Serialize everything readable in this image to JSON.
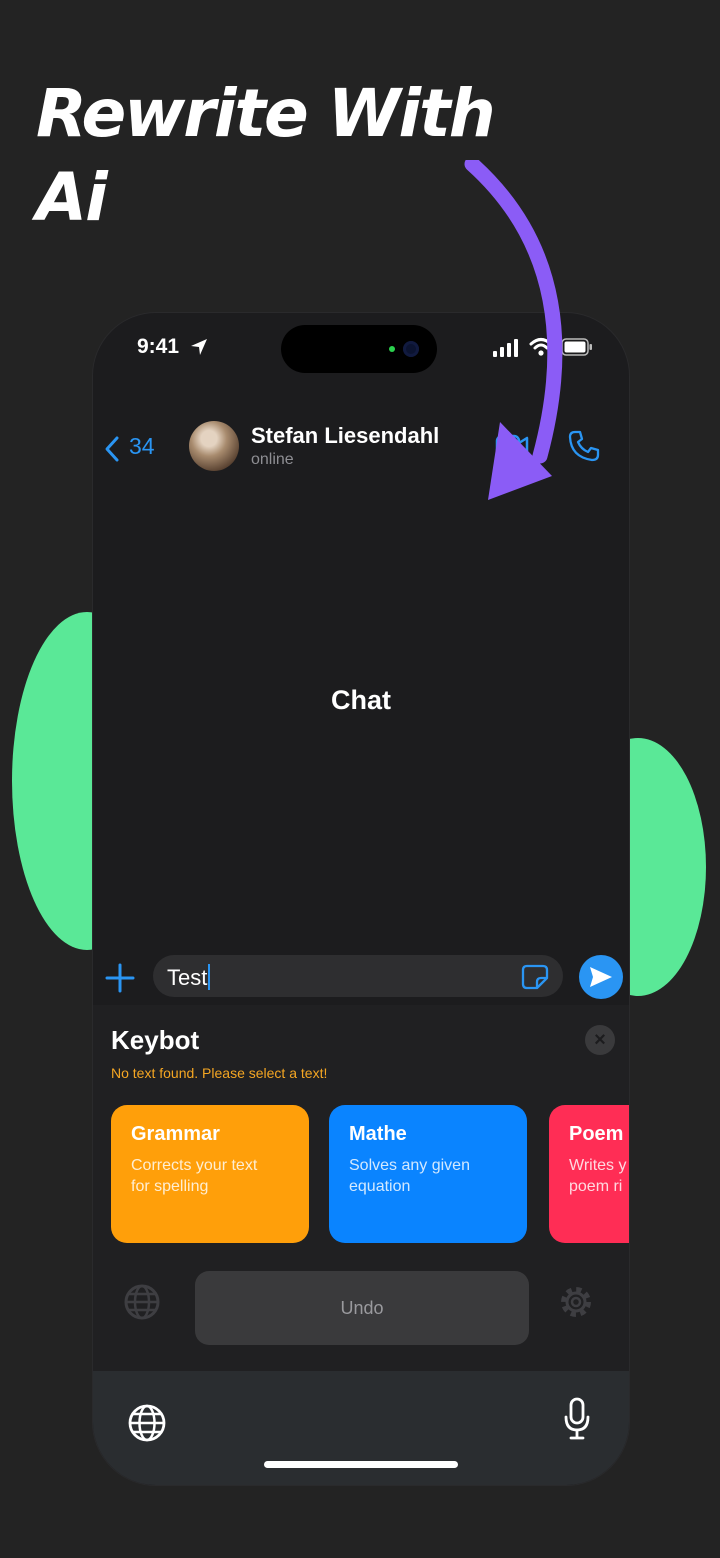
{
  "headline": {
    "line1": "Rewrite With",
    "line2": "Ai"
  },
  "status_bar": {
    "time": "9:41"
  },
  "chat_header": {
    "back_count": "34",
    "contact_name": "Stefan Liesendahl",
    "contact_status": "online"
  },
  "chat": {
    "placeholder_label": "Chat"
  },
  "composer": {
    "text": "Test"
  },
  "keybot": {
    "title": "Keybot",
    "hint": "No text found. Please select a text!",
    "close_glyph": "×",
    "cards": [
      {
        "title": "Grammar",
        "description_line1": "Corrects your text",
        "description_line2": "for spelling",
        "color": "#ff9f0a"
      },
      {
        "title": "Mathe",
        "description_line1": "Solves any given",
        "description_line2": "equation",
        "color": "#0a84ff"
      },
      {
        "title": "Poem",
        "description_line1": "Writes y",
        "description_line2": "poem ri",
        "color": "#ff2d55"
      }
    ],
    "undo_label": "Undo"
  },
  "colors": {
    "accent_blue": "#2a95f3",
    "arrow_purple": "#8b5cf6",
    "blob_green": "#5ae897",
    "hint_orange": "#f5a623"
  },
  "icons": [
    "location-arrow-icon",
    "signal-icon",
    "wifi-icon",
    "battery-icon",
    "back-chevron-icon",
    "video-call-icon",
    "phone-call-icon",
    "plus-icon",
    "sticker-icon",
    "send-icon",
    "globe-icon",
    "settings-icon",
    "microphone-icon"
  ]
}
